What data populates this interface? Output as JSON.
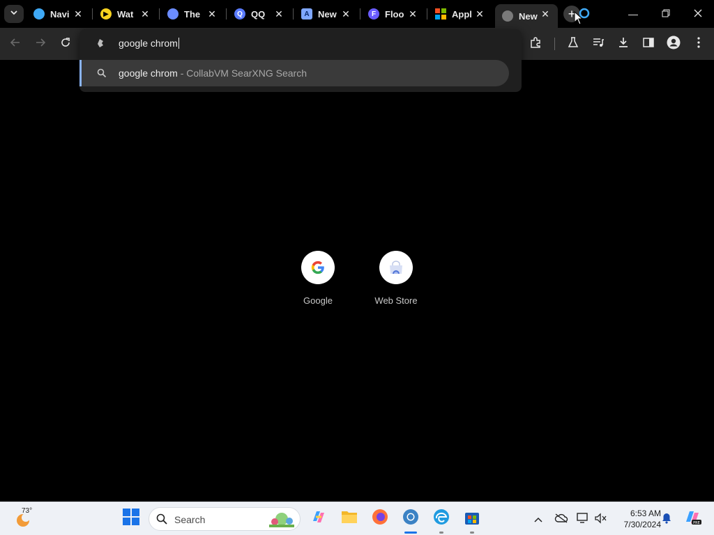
{
  "tabs": [
    {
      "title": "Navi",
      "favicon": "world-icon",
      "color": "#3fa9f5"
    },
    {
      "title": "Wat",
      "favicon": "play-icon",
      "color": "#f7d21f"
    },
    {
      "title": "The",
      "favicon": "bird-icon",
      "color": "#6b8cff"
    },
    {
      "title": "QQ",
      "favicon": "q-icon",
      "color": "#5a7bff"
    },
    {
      "title": "New",
      "favicon": "a-icon",
      "color": "#7fa7ff"
    },
    {
      "title": "Floo",
      "favicon": "f-icon",
      "color": "#6a5cff"
    },
    {
      "title": "Appl",
      "favicon": "windows-icon",
      "color": "#f25022"
    },
    {
      "title": "New",
      "favicon": "globe-icon",
      "color": "#9a9a9a",
      "active": true
    }
  ],
  "omnibox": {
    "input": "google chrom",
    "suggestion_query": "google chrom",
    "suggestion_source": " - CollabVM SearXNG Search"
  },
  "shortcuts": [
    {
      "label": "Google"
    },
    {
      "label": "Web Store"
    }
  ],
  "taskbar": {
    "weather_temp": "73°",
    "search_placeholder": "Search",
    "time": "6:53 AM",
    "date": "7/30/2024"
  },
  "colors": {
    "accent": "#8ab4f8",
    "toolbar_bg": "#282828",
    "page_bg": "#000000",
    "taskbar_bg": "#eef1f6"
  }
}
